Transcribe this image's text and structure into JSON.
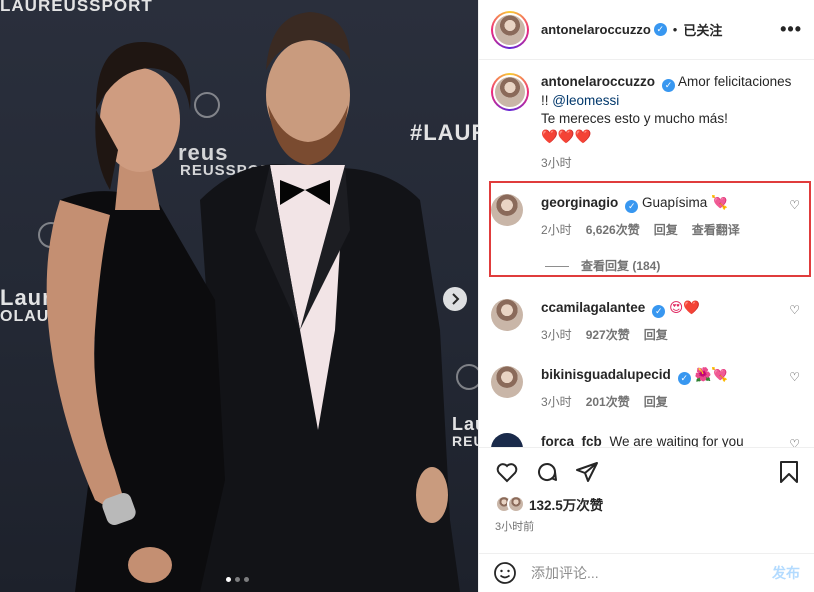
{
  "photo": {
    "backdrop_texts": [
      "LAUREUSSPORT",
      "#LAUR",
      "reus",
      "REUSSPORT",
      "Laur",
      "OLAUR",
      "Lau",
      "REUS"
    ],
    "carousel_dots": 3,
    "active_dot": 0
  },
  "header": {
    "username": "antonelaroccuzzo",
    "separator": "•",
    "follow_label": "已关注",
    "more_label": "•••"
  },
  "caption": {
    "username": "antonelaroccuzzo",
    "text_part1": "Amor felicitaciones !!",
    "mention": "@leomessi",
    "text_part2": "Te mereces esto y mucho más!",
    "emoji": "❤️❤️❤️",
    "time": "3小时"
  },
  "comments": [
    {
      "username": "georginagio",
      "text": "Guapísima",
      "emoji": "💘",
      "time": "2小时",
      "likes": "6,626次赞",
      "reply": "回复",
      "translate": "查看翻译",
      "view_replies": "查看回复 (184)",
      "verified": true
    },
    {
      "username": "ccamilagalantee",
      "text": "",
      "emoji": "😍❤️",
      "time": "3小时",
      "likes": "927次赞",
      "reply": "回复",
      "verified": true
    },
    {
      "username": "bikinisguadalupecid",
      "text": "",
      "emoji": "🌺💘",
      "time": "3小时",
      "likes": "201次赞",
      "reply": "回复",
      "verified": true
    },
    {
      "username": "forca_fcb",
      "text": "We are waiting for you",
      "emoji": "",
      "verified": false
    }
  ],
  "actions": {
    "like_icon": "heart-icon",
    "comment_icon": "comment-icon",
    "share_icon": "share-icon",
    "save_icon": "bookmark-icon",
    "likes_count": "132.5万次赞",
    "posted_ago": "3小时前"
  },
  "composer": {
    "emoji_icon": "smiley-icon",
    "placeholder": "添加评论...",
    "post_label": "发布"
  },
  "colors": {
    "highlight_border": "#e03c3c",
    "verified": "#3897f0",
    "post_disabled": "#b3dbff",
    "mention": "#00376b"
  }
}
